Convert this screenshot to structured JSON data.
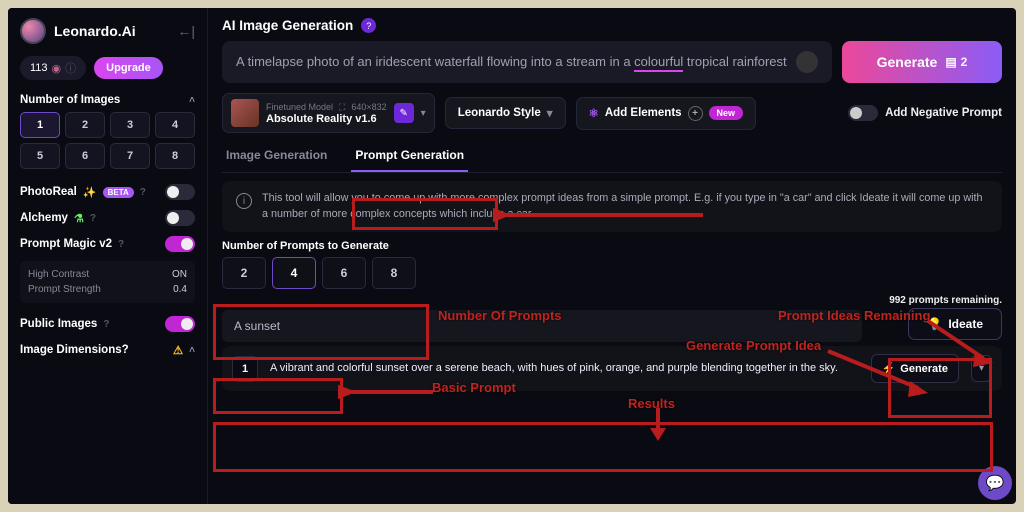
{
  "brand": "Leonardo.Ai",
  "tokens": "113",
  "upgrade": "Upgrade",
  "sections": {
    "numImages": "Number of Images",
    "photoreal": "PhotoReal",
    "alchemy": "Alchemy",
    "promptMagic": "Prompt Magic v2",
    "publicImages": "Public Images",
    "imageDims": "Image Dimensions"
  },
  "beta": "BETA",
  "numImageOptions": [
    "1",
    "2",
    "3",
    "4",
    "5",
    "6",
    "7",
    "8"
  ],
  "subSettings": {
    "highContrast": {
      "label": "High Contrast",
      "value": "ON"
    },
    "promptStrength": {
      "label": "Prompt Strength",
      "value": "0.4"
    }
  },
  "pageTitle": "AI Image Generation",
  "prompt_pre": "A timelapse photo of an iridescent waterfall flowing into a stream in a ",
  "prompt_underline": "colourful",
  "prompt_post": " tropical rainforest",
  "generate": "Generate",
  "generateCount": "2",
  "model": {
    "kind": "Finetuned Model",
    "dims": "640×832",
    "name": "Absolute Reality v1.6"
  },
  "styleChip": "Leonardo Style",
  "addElements": "Add Elements",
  "newBadge": "New",
  "negPrompt": "Add Negative Prompt",
  "tabs": {
    "imageGen": "Image Generation",
    "promptGen": "Prompt Generation"
  },
  "info": "This tool will allow you to come up with more complex prompt ideas from a simple prompt. E.g. if you type in \"a car\" and click Ideate it will come up with a number of more complex concepts which include a car.",
  "numPromptsLabel": "Number of Prompts to Generate",
  "numPromptOptions": [
    "2",
    "4",
    "6",
    "8"
  ],
  "basicPrompt": "A sunset",
  "remaining": "992 prompts remaining.",
  "ideate": "Ideate",
  "result": {
    "n": "1",
    "text": "A vibrant and colorful sunset over a serene beach, with hues of pink, orange, and purple blending together in the sky.",
    "btn": "Generate"
  },
  "anno": {
    "numPrompts": "Number Of Prompts",
    "basicPrompt": "Basic Prompt",
    "results": "Results",
    "genIdea": "Generate Prompt Idea",
    "remaining": "Prompt Ideas Remaining"
  }
}
